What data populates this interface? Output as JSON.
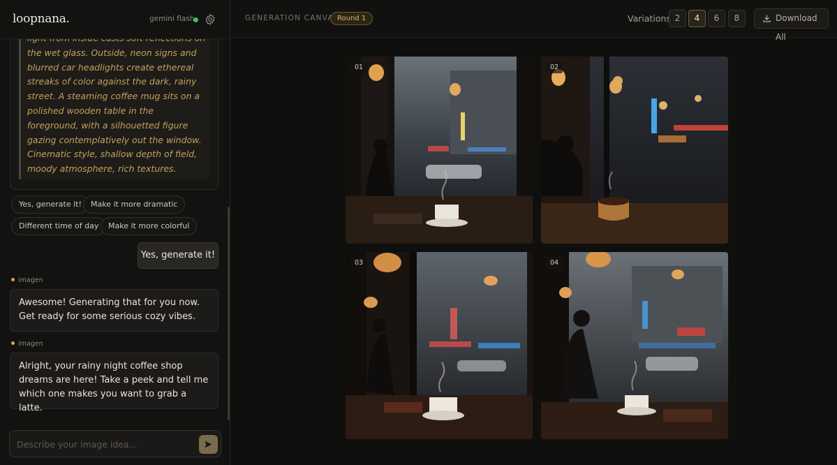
{
  "app": {
    "logo": "loopnana.",
    "model": "gemini flash",
    "status_color": "#3fc06a",
    "settings_icon": "gear-icon"
  },
  "chat": {
    "prompt_text": "photorealistic, with a glowing amber light from inside casts soft reflections on the wet glass. Outside, neon signs and blurred car headlights create ethereal streaks of color against the dark, rainy street. A steaming coffee mug sits on a polished wooden table in the foreground, with a silhouetted figure gazing contemplatively out the window. Cinematic style, shallow depth of field, moody atmosphere, rich textures.",
    "suggestions": [
      "Yes, generate it!",
      "Make it more dramatic",
      "Different time of day",
      "Make it more colorful"
    ],
    "user_message": "Yes, generate it!",
    "bot_messages": [
      {
        "sender": "imagen",
        "text": "Awesome! Generating that for you now. Get ready for some serious cozy vibes."
      },
      {
        "sender": "imagen",
        "text": "Alright, your rainy night coffee shop dreams are here! Take a peek and tell me which one makes you want to grab a latte."
      }
    ],
    "input_placeholder": "Describe your image idea...",
    "send_icon": "send-icon"
  },
  "canvas": {
    "title": "GENERATION CANVAS",
    "round": "Round 1",
    "variations_label": "Variations",
    "variation_options": [
      "2",
      "4",
      "6",
      "8"
    ],
    "selected_variation": "4",
    "download_label": "Download All",
    "download_icon": "download-icon",
    "images": [
      {
        "number": "01"
      },
      {
        "number": "02"
      },
      {
        "number": "03"
      },
      {
        "number": "04"
      }
    ]
  },
  "colors": {
    "accent": "#d6a746",
    "prompt_text": "#c3a25a",
    "background": "#0f0f0e"
  }
}
